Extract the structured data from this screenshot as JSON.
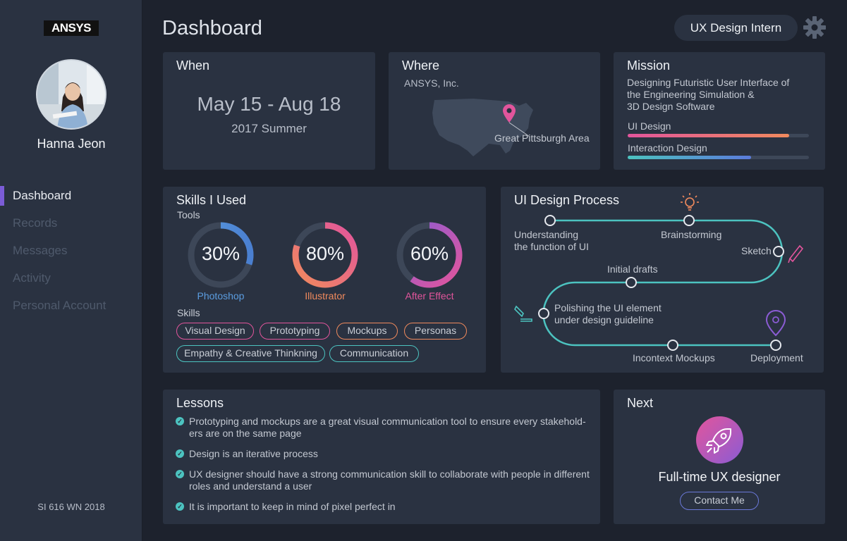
{
  "brand": {
    "logo_text": "ANSYS"
  },
  "user": {
    "name": "Hanna Jeon"
  },
  "nav": {
    "items": [
      {
        "label": "Dashboard",
        "active": true
      },
      {
        "label": "Records"
      },
      {
        "label": "Messages"
      },
      {
        "label": "Activity"
      },
      {
        "label": "Personal Account"
      }
    ]
  },
  "footer": {
    "note": "SI 616 WN 2018"
  },
  "header": {
    "title": "Dashboard",
    "role": "UX Design Intern",
    "settings_icon": "gear-icon"
  },
  "when": {
    "title": "When",
    "dates": "May 15 - Aug 18",
    "season": "2017 Summer"
  },
  "where": {
    "title": "Where",
    "company": "ANSYS, Inc.",
    "location": "Great Pittsburgh Area",
    "icon": "map-pin-icon"
  },
  "mission": {
    "title": "Mission",
    "lines": [
      "Designing Futuristic User Interface of",
      "the Engineering Simulation &",
      "3D Design Software"
    ],
    "bars": [
      {
        "label": "UI Design",
        "value": 0.89,
        "color_from": "#e2559c",
        "color_to": "#f08a5d"
      },
      {
        "label": "Interaction Design",
        "value": 0.68,
        "color_from": "#4cc3c0",
        "color_to": "#5b7bdb"
      }
    ]
  },
  "skills": {
    "title": "Skills I Used",
    "tools_label": "Tools",
    "tools": [
      {
        "percent": "30%",
        "value": 0.3,
        "name": "Photoshop",
        "color": "#5b9de0",
        "color2": "#4a7fd0"
      },
      {
        "percent": "80%",
        "value": 0.8,
        "name": "Illustrator",
        "color": "#f08a5d",
        "color2": "#e2559c"
      },
      {
        "percent": "60%",
        "value": 0.6,
        "name": "After Effect",
        "color": "#e2559c",
        "color2": "#8b5cd4"
      }
    ],
    "skills_label": "Skills",
    "tags": [
      {
        "label": "Visual Design",
        "color": "#e2559c"
      },
      {
        "label": "Prototyping",
        "color": "#e2559c"
      },
      {
        "label": "Mockups",
        "color": "#f08a5d"
      },
      {
        "label": "Personas",
        "color": "#f08a5d"
      },
      {
        "label": "Empathy & Creative Thinkning",
        "color": "#4cc3c0"
      },
      {
        "label": "Communication",
        "color": "#4cc3c0"
      }
    ]
  },
  "process": {
    "title": "UI Design Process",
    "steps": [
      {
        "label": "Understanding\nthe function of UI"
      },
      {
        "label": "Brainstorming"
      },
      {
        "label": "Sketch"
      },
      {
        "label": "Initial drafts"
      },
      {
        "label": "Polishing the UI element\nunder design guideline"
      },
      {
        "label": "Incontext Mockups"
      },
      {
        "label": "Deployment"
      }
    ],
    "icons": [
      "lightbulb-icon",
      "pencil-icon",
      "pen-tool-icon",
      "map-pin-icon"
    ],
    "line_color": "#4cc3c0"
  },
  "lessons": {
    "title": "Lessons",
    "items": [
      "Prototyping and mockups are a great visual communication tool to ensure every stakehold-\ners are on the same page",
      "Design is an iterative process",
      "UX designer should have a strong communication skill to collaborate with people in different\nroles and understand a user",
      "It is important to keep in mind of pixel perfect in"
    ]
  },
  "next": {
    "title": "Next",
    "role": "Full-time UX designer",
    "button": "Contact Me",
    "icon": "rocket-icon"
  }
}
